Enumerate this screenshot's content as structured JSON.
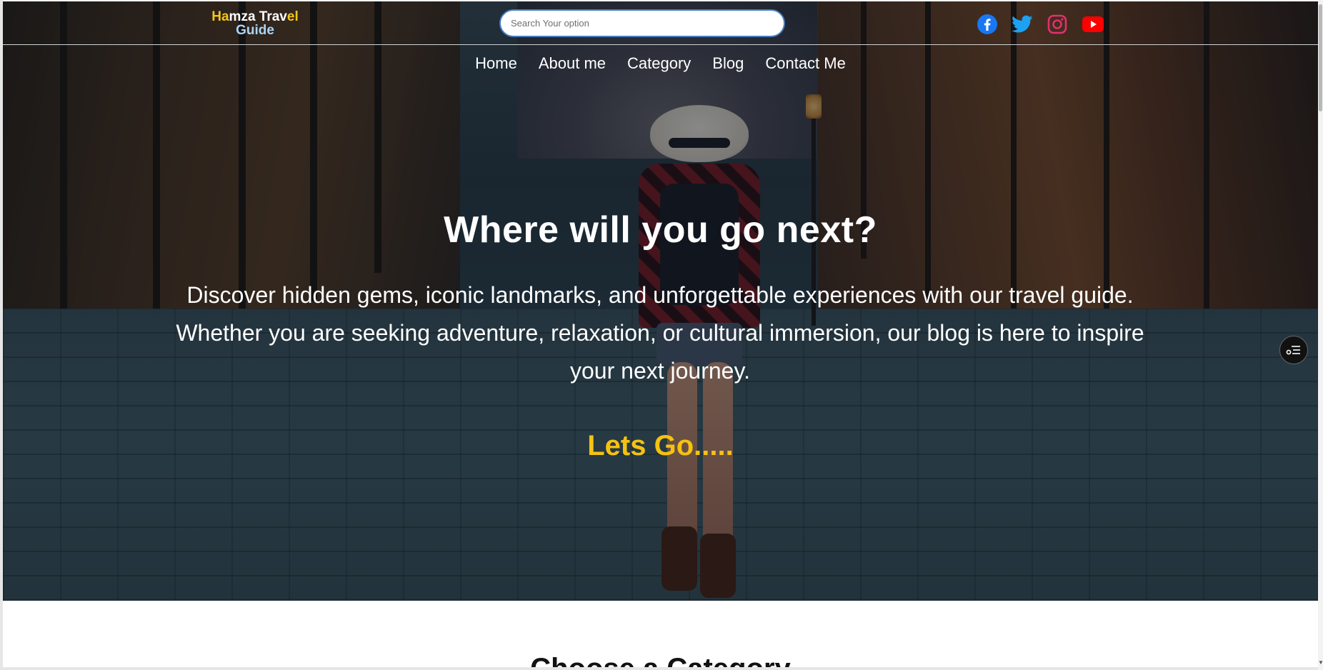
{
  "header": {
    "logo": {
      "line1_accent_a": "Ha",
      "line1_rest_a": "mza Trav",
      "line1_accent_b": "el",
      "line2": "Guide"
    },
    "search": {
      "placeholder": "Search Your option",
      "value": ""
    },
    "social": [
      {
        "name": "facebook-icon",
        "color": "#1877f2"
      },
      {
        "name": "twitter-icon",
        "color": "#1da1f2"
      },
      {
        "name": "instagram-icon",
        "color": "#e1306c"
      },
      {
        "name": "youtube-icon",
        "color": "#ff0000"
      }
    ]
  },
  "nav": {
    "items": [
      "Home",
      "About me",
      "Category",
      "Blog",
      "Contact Me"
    ]
  },
  "hero": {
    "title": "Where will you go next?",
    "description": "Discover hidden gems, iconic landmarks, and unforgettable experiences with our travel guide. Whether you are seeking adventure, relaxation, or cultural immersion, our blog is here to inspire your next journey.",
    "cta": "Lets Go....."
  },
  "section": {
    "title": "Choose a Category"
  },
  "colors": {
    "accent_yellow": "#f5c20f",
    "logo_blue": "#a9d4f5",
    "nav_text": "#ffffff"
  }
}
